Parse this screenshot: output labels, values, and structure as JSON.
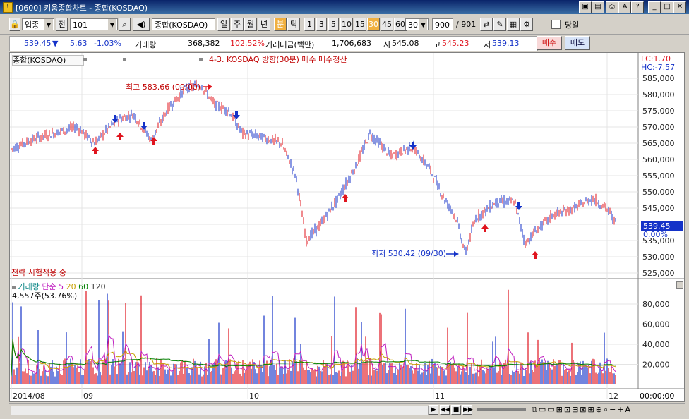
{
  "window": {
    "title": "[0600] 키움종합차트 - 종합(KOSDAQ)"
  },
  "toolbar": {
    "market_type": "업종",
    "all_label": "전",
    "code": "101",
    "name": "종합(KOSDAQ)",
    "periods": [
      "일",
      "주",
      "월",
      "년",
      "분",
      "틱"
    ],
    "selected_period": "분",
    "intervals": [
      "1",
      "3",
      "5",
      "10",
      "15",
      "30",
      "45",
      "60"
    ],
    "selected_interval": "30",
    "interval_value": "30",
    "count_value": "900",
    "count_total": "/ 901",
    "today_label": "당일"
  },
  "quote": {
    "price": "539.45",
    "change_arrow": "▼",
    "change": "5.63",
    "change_pct": "-1.03%",
    "volume_label": "거래량",
    "volume": "368,382",
    "volume_pct": "102.52%",
    "amount_label": "거래대금(백만)",
    "amount": "1,706,683",
    "open_label": "시",
    "open": "545.08",
    "high_label": "고",
    "high": "545.23",
    "low_label": "저",
    "low": "539.13",
    "buy_label": "매수",
    "sell_label": "매도"
  },
  "chart": {
    "name_tag": "종합(KOSDAQ)",
    "strategy": "4-3. KOSDAQ 방향(30분) 매수  매수청산",
    "lc": "LC:1.70",
    "hc": "HC:-7.57",
    "high_annotation": "최고 583.66 (09/00)",
    "low_annotation": "최저 530.42 (09/30)",
    "last_price": "539.45",
    "last_pct": "0.00%",
    "strategy_status": "전략 시험적용 중",
    "price_ticks": [
      "585,000",
      "580,000",
      "575,000",
      "570,000",
      "565,000",
      "560,000",
      "555,000",
      "550,000",
      "545,000",
      "540,000",
      "535,000",
      "530,000",
      "525,000"
    ],
    "volume_legend": {
      "name": "거래량",
      "ma_label": "단순",
      "ma5": "5",
      "ma20": "20",
      "ma60": "60",
      "ma120": "120",
      "value": "4,557주(53.76%)"
    },
    "volume_ticks": [
      "80,000",
      "60,000",
      "40,000",
      "20,000"
    ],
    "date_labels": [
      "2014/08",
      "09",
      "10",
      "11",
      "12"
    ],
    "time_label": "00:00:00"
  },
  "colors": {
    "up": "#e0141e",
    "down": "#1432c8",
    "ma5": "#c020c0",
    "ma20": "#c8a000",
    "ma60": "#008000"
  }
}
